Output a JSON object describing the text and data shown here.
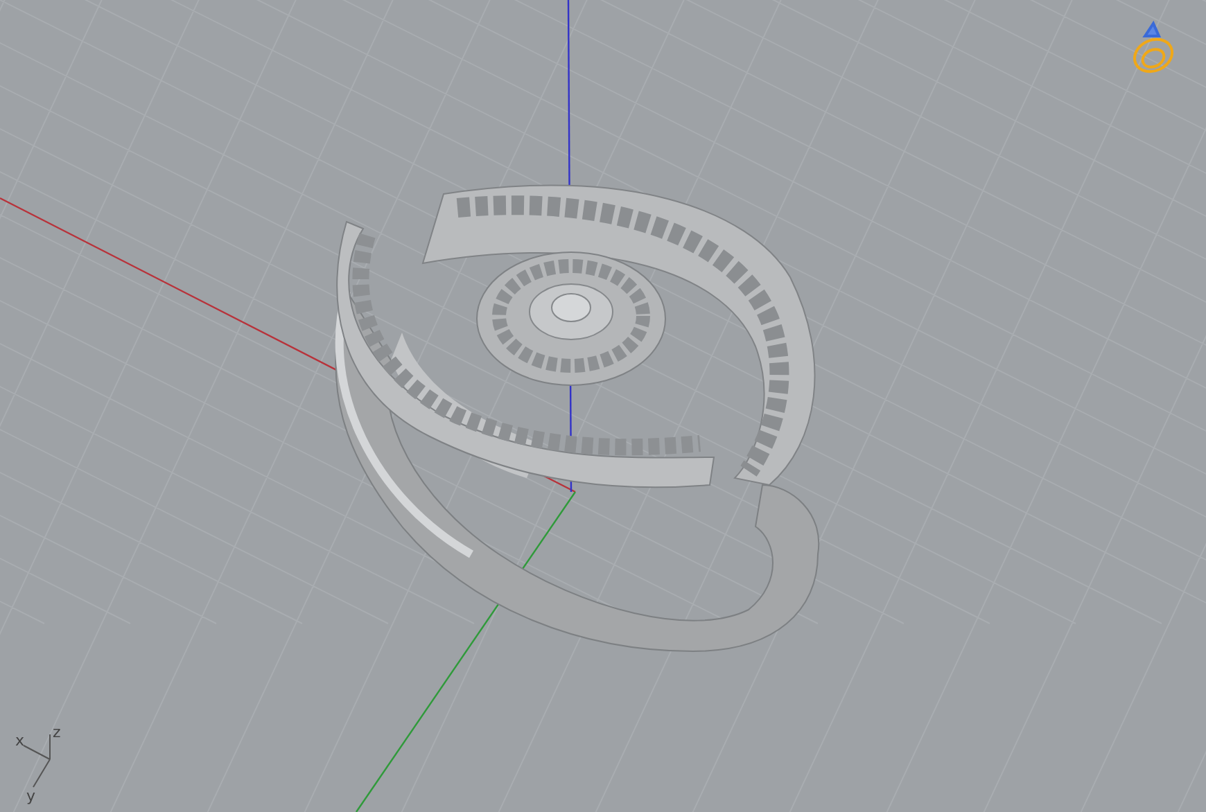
{
  "viewport": {
    "axis_labels": [
      "x",
      "z",
      "y"
    ]
  }
}
